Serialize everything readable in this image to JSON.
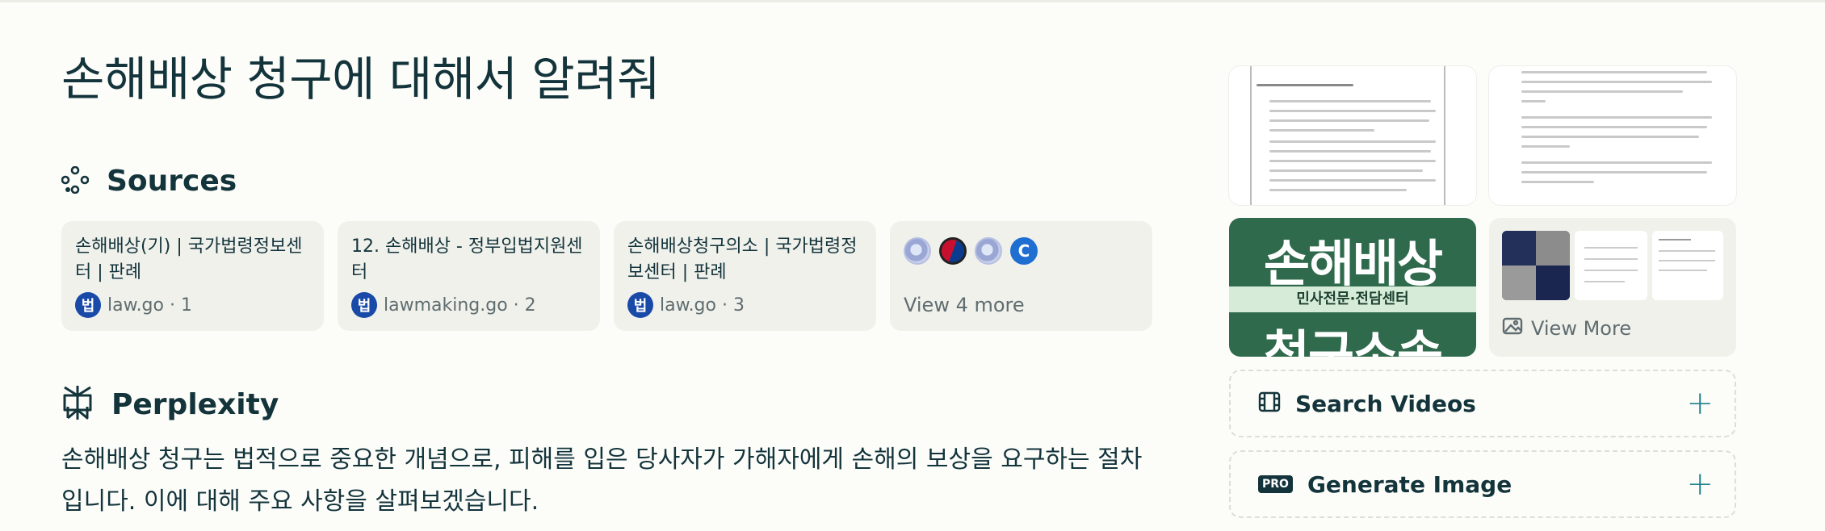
{
  "query": {
    "title": "손해배상 청구에 대해서 알려줘"
  },
  "sources": {
    "heading": "Sources",
    "icon": "sources-icon",
    "cards": [
      {
        "title": "손해배상(기) | 국가법령정보센터 | 판례",
        "favicon_text": "법",
        "domain_index": "law.go · 1"
      },
      {
        "title": "12. 손해배상 - 정부입법지원센터",
        "favicon_text": "법",
        "domain_index": "lawmaking.go · 2"
      },
      {
        "title": "손해배상청구의소 | 국가법령정보센터 | 판례",
        "favicon_text": "법",
        "domain_index": "law.go · 3"
      }
    ],
    "more": {
      "label": "View 4 more",
      "icons": [
        "globe-icon",
        "korea-flag-icon",
        "globe-icon",
        "c-letter-icon"
      ],
      "letter": "C"
    }
  },
  "answer": {
    "heading": "Perplexity",
    "icon": "perplexity-logo-icon",
    "text": "손해배상 청구는 법적으로 중요한 개념으로, 피해를 입은 당사자가 가해자에게 손해의 보상을 요구하는 절차입니다. 이에 대해 주요 사항을 살펴보겠습니다."
  },
  "media": {
    "ad_image": {
      "top_text": "손해배상",
      "band_text": "민사전문·전담센터",
      "bottom_text": "청구소송"
    },
    "view_more_label": "View More",
    "view_more_icon": "image-icon"
  },
  "actions": [
    {
      "label": "Search Videos",
      "icon": "film-icon",
      "plus": "+"
    },
    {
      "label": "Generate Image",
      "icon": "pro-badge",
      "badge": "PRO",
      "plus": "+"
    }
  ],
  "colors": {
    "background": "#fcfcf9",
    "text": "#13343b",
    "card": "#f1f1ec",
    "accent": "#20808d",
    "favicon": "#1a4aa8"
  }
}
